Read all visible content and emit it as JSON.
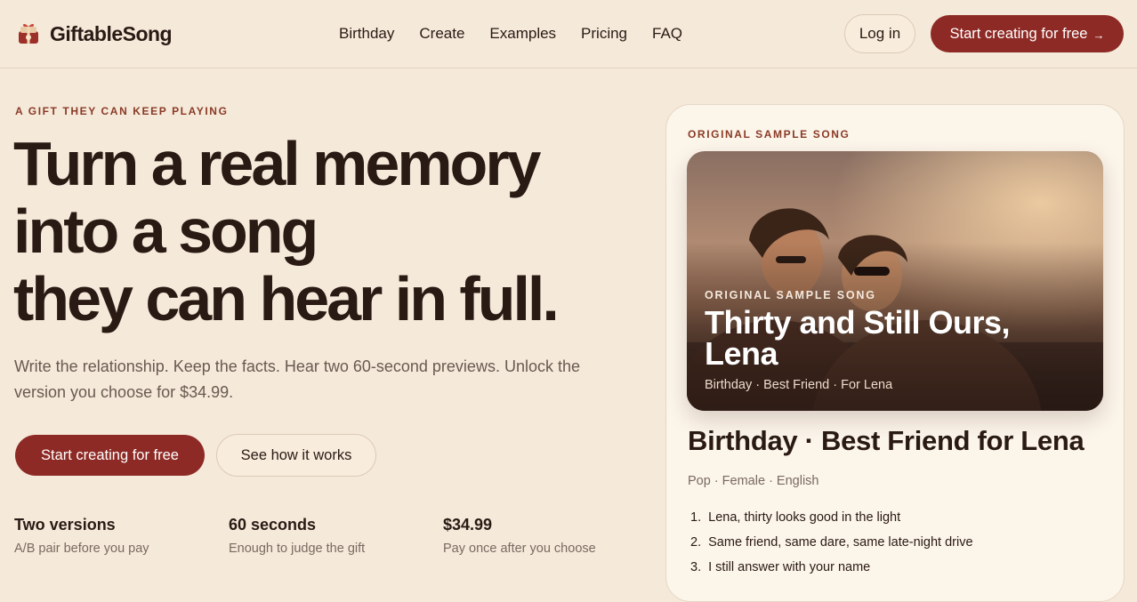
{
  "header": {
    "brand": "GiftableSong",
    "nav": [
      "Birthday",
      "Create",
      "Examples",
      "Pricing",
      "FAQ"
    ],
    "login_label": "Log in",
    "cta_label": "Start creating for free",
    "cta_arrow": "→"
  },
  "hero": {
    "eyebrow": "A GIFT THEY CAN KEEP PLAYING",
    "headline": [
      "Turn a real memory",
      "into a song",
      "they can hear in full."
    ],
    "subtext": "Write the relationship. Keep the facts. Hear two 60-second previews. Unlock the version you choose for $34.99.",
    "primary_label": "Start creating for free",
    "secondary_label": "See how it works",
    "stats": [
      {
        "title": "Two versions",
        "desc": "A/B pair before you pay"
      },
      {
        "title": "60 seconds",
        "desc": "Enough to judge the gift"
      },
      {
        "title": "$34.99",
        "desc": "Pay once after you choose"
      }
    ]
  },
  "sample_card": {
    "eyebrow": "ORIGINAL SAMPLE SONG",
    "photo": {
      "eyebrow": "ORIGINAL SAMPLE SONG",
      "title": "Thirty and Still Ours, Lena",
      "meta": "Birthday · Best Friend · For Lena"
    },
    "title": "Birthday · Best Friend for Lena",
    "meta": "Pop · Female · English",
    "lyrics": [
      {
        "num": "1.",
        "text": "Lena, thirty looks good in the light"
      },
      {
        "num": "2.",
        "text": "Same friend, same dare, same late-night drive"
      },
      {
        "num": "3.",
        "text": "I still answer with your name"
      }
    ]
  },
  "colors": {
    "background": "#f5e9da",
    "accent": "#8e2a25",
    "eyebrow": "#8a3a26",
    "text": "#2a1a14",
    "muted": "#6a5a50"
  }
}
